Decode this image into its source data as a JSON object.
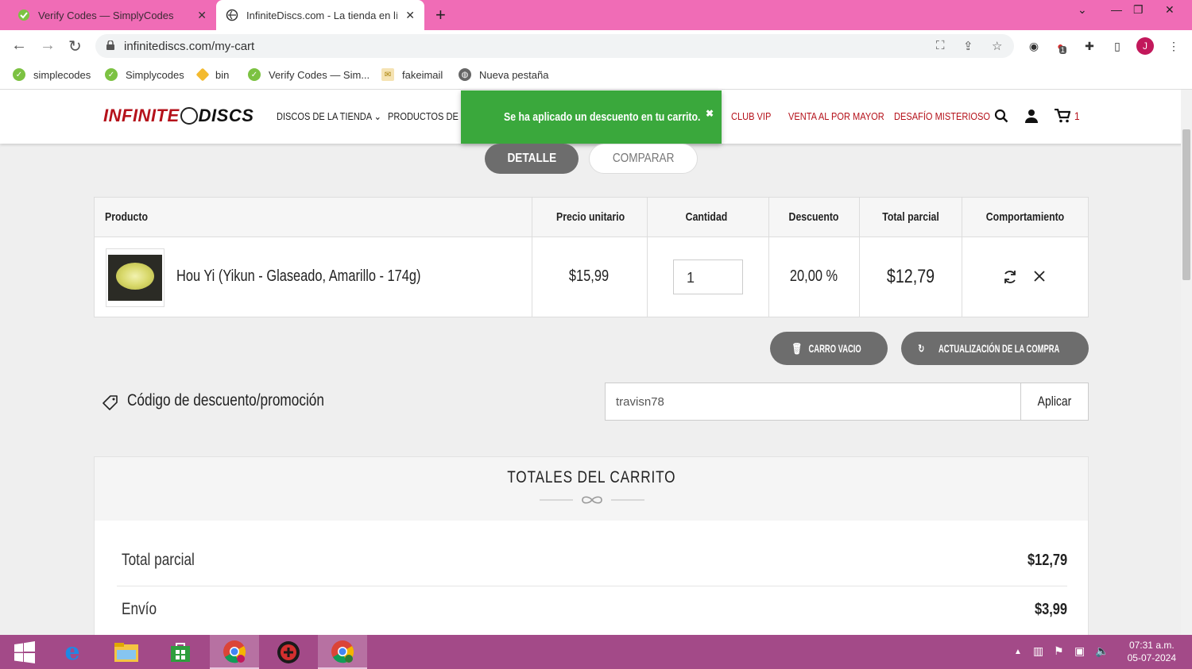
{
  "browser": {
    "tabs": [
      {
        "title": "Verify Codes — SimplyCodes",
        "active": false
      },
      {
        "title": "InfiniteDiscs.com - La tienda en línea",
        "active": true
      }
    ],
    "url": "infinitediscs.com/my-cart",
    "bookmarks": [
      "simplecodes",
      "Simplycodes",
      "bin",
      "Verify Codes — Sim...",
      "fakeimail",
      "Nueva pestaña"
    ],
    "profile_initial": "J",
    "ext_badge": "1"
  },
  "site": {
    "logo_part1": "INFINITE",
    "logo_part2": "DISCS",
    "nav": [
      "DISCOS DE LA TIENDA",
      "PRODUCTOS DE LA",
      "CLUB VIP",
      "VENTA AL POR MAYOR",
      "DESAFÍO MISTERIOSO"
    ],
    "cart_count": "1",
    "toast": "Se ha aplicado un descuento en tu carrito.",
    "toast_close": "✖"
  },
  "view_tabs": {
    "detail": "DETALLE",
    "compare": "COMPARAR"
  },
  "cart": {
    "headers": [
      "Producto",
      "Precio unitario",
      "Cantidad",
      "Descuento",
      "Total parcial",
      "Comportamiento"
    ],
    "row": {
      "product": "Hou Yi (Yikun - Glaseado, Amarillo - 174g)",
      "unit_price": "$15,99",
      "quantity": "1",
      "discount": "20,00 %",
      "subtotal": "$12,79"
    },
    "empty_cart": "CARRO VACIO",
    "update_cart": "ACTUALIZACIÓN DE LA COMPRA"
  },
  "promo": {
    "label": "Código de descuento/promoción",
    "value": "travisn78",
    "apply": "Aplicar"
  },
  "totals": {
    "title": "TOTALES DEL CARRITO",
    "rows": [
      {
        "label": "Total parcial",
        "value": "$12,79"
      },
      {
        "label": "Envío",
        "value": "$3,99"
      }
    ]
  },
  "taskbar": {
    "time": "07:31 a.m.",
    "date": "05-07-2024"
  },
  "colors": {
    "tabbar": "#f06cb6",
    "brand_red": "#b5121b",
    "toast_green": "#3aa83c",
    "taskbar": "#a34a88"
  }
}
